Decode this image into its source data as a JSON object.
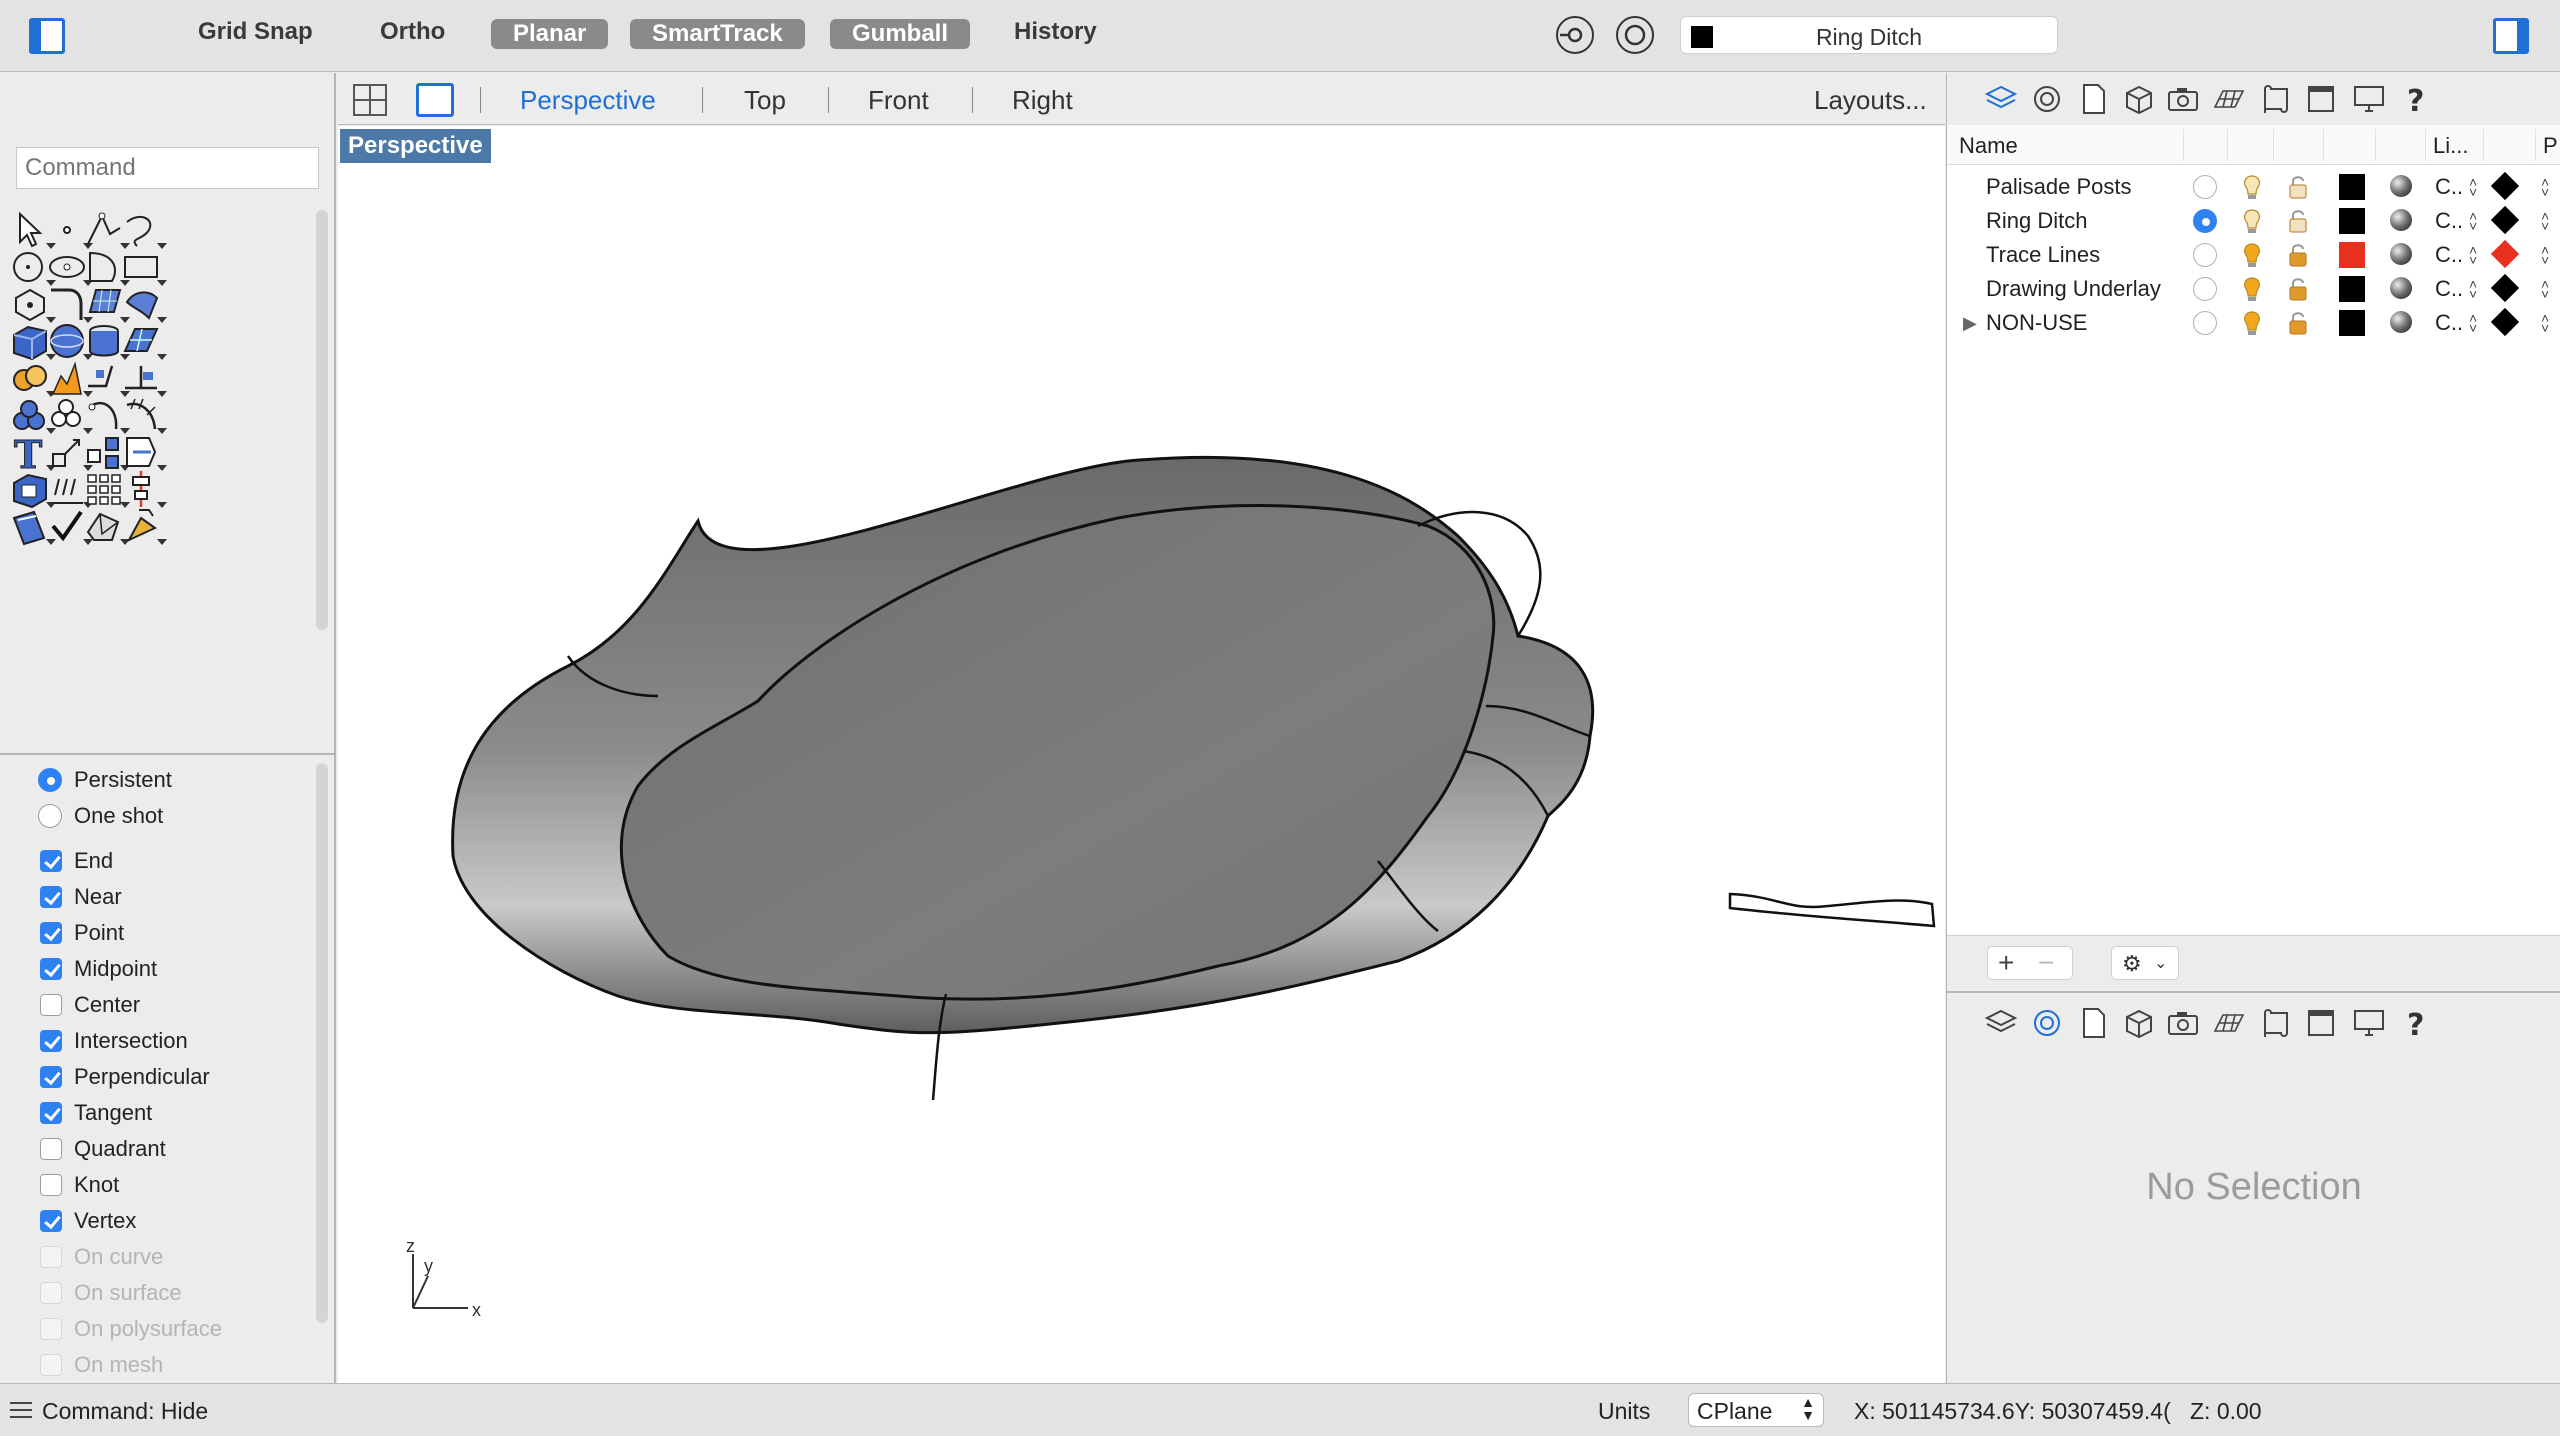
{
  "topbar": {
    "grid_snap": "Grid Snap",
    "ortho": "Ortho",
    "planar": "Planar",
    "smarttrack": "SmartTrack",
    "gumball": "Gumball",
    "history": "History",
    "current_layer": "Ring Ditch"
  },
  "command": {
    "placeholder": "Command"
  },
  "view_tabs": [
    "Perspective",
    "Top",
    "Front",
    "Right"
  ],
  "layouts_label": "Layouts...",
  "viewport": {
    "label": "Perspective",
    "axis_z": "z",
    "axis_y": "y",
    "axis_x": "x"
  },
  "osnap": {
    "modes": [
      {
        "label": "Persistent",
        "selected": true
      },
      {
        "label": "One shot",
        "selected": false
      }
    ],
    "items": [
      {
        "label": "End",
        "checked": true,
        "enabled": true
      },
      {
        "label": "Near",
        "checked": true,
        "enabled": true
      },
      {
        "label": "Point",
        "checked": true,
        "enabled": true
      },
      {
        "label": "Midpoint",
        "checked": true,
        "enabled": true
      },
      {
        "label": "Center",
        "checked": false,
        "enabled": true
      },
      {
        "label": "Intersection",
        "checked": true,
        "enabled": true
      },
      {
        "label": "Perpendicular",
        "checked": true,
        "enabled": true
      },
      {
        "label": "Tangent",
        "checked": true,
        "enabled": true
      },
      {
        "label": "Quadrant",
        "checked": false,
        "enabled": true
      },
      {
        "label": "Knot",
        "checked": false,
        "enabled": true
      },
      {
        "label": "Vertex",
        "checked": true,
        "enabled": true
      },
      {
        "label": "On curve",
        "checked": false,
        "enabled": false
      },
      {
        "label": "On surface",
        "checked": false,
        "enabled": false
      },
      {
        "label": "On polysurface",
        "checked": false,
        "enabled": false
      },
      {
        "label": "On mesh",
        "checked": false,
        "enabled": false
      }
    ]
  },
  "layers": {
    "headers": {
      "name": "Name",
      "linetype": "Li...",
      "print": "P"
    },
    "rows": [
      {
        "name": "Palisade Posts",
        "current": false,
        "on": false,
        "color": "#000000",
        "linetype": "C..",
        "print_color": "#000000",
        "expandable": false
      },
      {
        "name": "Ring Ditch",
        "current": true,
        "on": false,
        "color": "#000000",
        "linetype": "C..",
        "print_color": "#000000",
        "expandable": false
      },
      {
        "name": "Trace Lines",
        "current": false,
        "on": true,
        "color": "#e8301c",
        "linetype": "C..",
        "print_color": "#e8301c",
        "expandable": false
      },
      {
        "name": "Drawing Underlay",
        "current": false,
        "on": true,
        "color": "#000000",
        "linetype": "C..",
        "print_color": "#000000",
        "expandable": false
      },
      {
        "name": "NON-USE",
        "current": false,
        "on": true,
        "color": "#000000",
        "linetype": "C..",
        "print_color": "#000000",
        "expandable": true
      }
    ],
    "add_label": "+",
    "remove_label": "−"
  },
  "properties": {
    "empty_text": "No Selection"
  },
  "status": {
    "command_text": "Command: Hide",
    "units_label": "Units",
    "cplane": "CPlane",
    "coords": "X: 501145734.6Y: 50307459.4(",
    "z": "Z: 0.00"
  },
  "colors": {
    "accent": "#1f6fd6",
    "viewport_label_bg": "#4d79a8",
    "check_blue": "#2f82f2"
  }
}
